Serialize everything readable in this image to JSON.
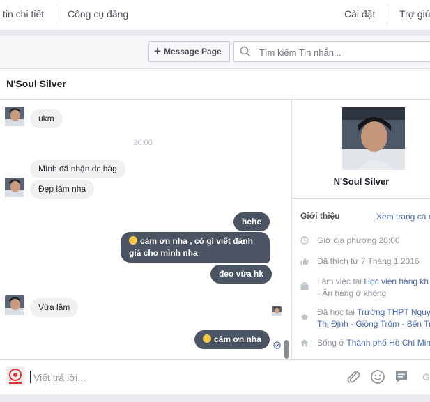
{
  "topnav": {
    "tabs": [
      "tin chi tiết",
      "Công cụ đăng",
      "Cài đặt",
      "Trợ giú"
    ]
  },
  "toolbar": {
    "message_page_label": "Message Page",
    "search_placeholder": "Tìm kiếm Tin nhắn..."
  },
  "conversation": {
    "title": "N'Soul Silver",
    "timestamp": "20:00",
    "messages": [
      {
        "from": "them",
        "text": "ukm"
      },
      {
        "from": "them",
        "text": "Mình đã nhận dc hàg"
      },
      {
        "from": "them",
        "text": "Đẹp lắm nha"
      },
      {
        "from": "me",
        "text": "hehe"
      },
      {
        "from": "me",
        "text": "cảm ơn nha , có gì viết đánh giá cho mình nha",
        "emoji": true
      },
      {
        "from": "me",
        "text": "đeo vừa hk"
      },
      {
        "from": "them",
        "text": "Vừa lắm"
      },
      {
        "from": "me",
        "text": "cảm ơn nha",
        "emoji": true
      }
    ]
  },
  "profile": {
    "name": "N'Soul Silver",
    "intro_label": "Giới thiệu",
    "intro_link": "Xem trang cá n",
    "rows": [
      {
        "icon": "clock-icon",
        "text": "Giờ địa phương 20:00"
      },
      {
        "icon": "like-icon",
        "text": "Đã thích từ 7 Tháng 1 2016"
      },
      {
        "icon": "briefcase-icon",
        "prefix": "Làm việc tại ",
        "link": "Học viện hàng kh",
        "line2": "- Ăn hàng ở không"
      },
      {
        "icon": "graduation-cap-icon",
        "prefix": "Đã học tại ",
        "link": "Trường THPT Nguy",
        "line2": "Thị Định - Giồng Trôm - Bến Tr"
      },
      {
        "icon": "home-icon",
        "prefix": "Sống ở ",
        "link": "Thành phố Hồ Chí Min"
      }
    ]
  },
  "composer": {
    "placeholder": "Viết trả lời...",
    "send_label": "G"
  },
  "colors": {
    "outgoing_bubble": "#4b5462",
    "incoming_bubble": "#f1f0f0",
    "link": "#4267b2"
  }
}
